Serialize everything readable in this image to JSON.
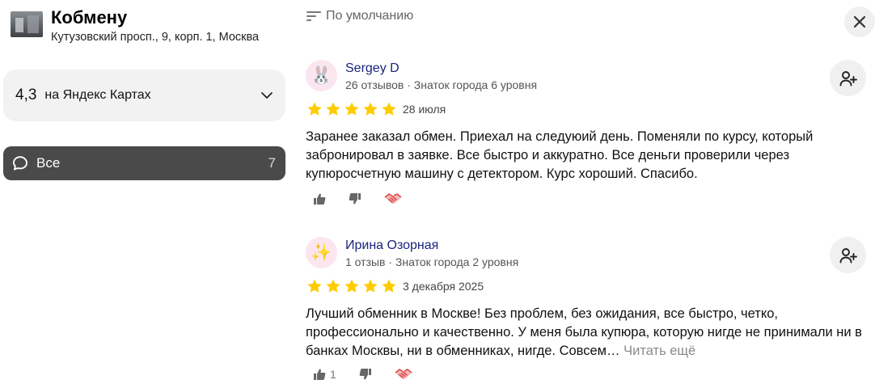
{
  "organization": {
    "name": "Кобмену",
    "address": "Кутузовский просп., 9, корп. 1, Москва",
    "thumbnail_icon": "storefront-photo"
  },
  "rating_card": {
    "value": "4,3",
    "source": "на Яндекс Картах",
    "icon": "chevron-down-icon"
  },
  "filter": {
    "label": "Все",
    "count": "7",
    "icon": "speech-bubble-icon"
  },
  "sort": {
    "label": "По умолчанию",
    "icon": "sort-lines-icon"
  },
  "close": {
    "icon": "close-icon"
  },
  "colors": {
    "star": "#ffcc00",
    "author": "#1a237e",
    "chip_bg": "#4a4a4a",
    "card_bg": "#f2f2f2",
    "read_more": "#8a8a8a"
  },
  "reviews": [
    {
      "author": "Sergey D",
      "avatar_emoji": "🐰",
      "meta": "26 отзывов · Знаток города 6 уровня",
      "rating": 5,
      "date": "28 июля",
      "text": "Заранее заказал обмен. Приехал на следуюий день. Поменяли по курсу, который забронировал в заявке. Все быстро и аккуратно. Все деньги проверили через купюросчетную машину с детектором. Курс хороший. Спасибо.",
      "read_more": "",
      "likes": ""
    },
    {
      "author": "Ирина Озорная",
      "avatar_emoji": "✨",
      "meta": "1 отзыв · Знаток города 2 уровня",
      "rating": 5,
      "date": "3 декабря 2025",
      "text": "Лучший обменник в Москве! Без проблем, без ожидания, все быстро, четко, профессионально и качественно. У меня была купюра, которую нигде не принимали ни в банках Москвы, ни в обменниках, нигде. Совсем…",
      "read_more": "Читать ещё",
      "likes": "1"
    }
  ]
}
